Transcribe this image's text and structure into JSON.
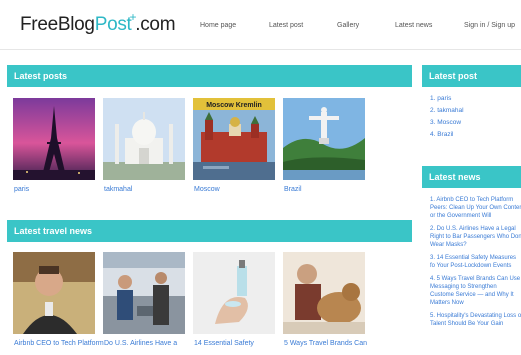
{
  "header": {
    "logo": {
      "part1": "FreeBlog",
      "part2": "Post",
      "plus": "+",
      "part3": ".com"
    },
    "nav": [
      "Home page",
      "Latest post",
      "Gallery",
      "Latest news",
      "Sign in / Sign up"
    ]
  },
  "latest_posts": {
    "title": "Latest posts",
    "items": [
      {
        "caption": "paris"
      },
      {
        "caption": "takmahal"
      },
      {
        "caption": "Moscow",
        "image_text": "Moscow Kremlin"
      },
      {
        "caption": "Brazil"
      }
    ]
  },
  "latest_travel_news": {
    "title": "Latest travel news",
    "items": [
      {
        "caption": "Airbnb CEO to Tech Platform"
      },
      {
        "caption": "Do U.S. Airlines Have a"
      },
      {
        "caption": "14 Essential Safety"
      },
      {
        "caption": "5 Ways Travel Brands Can"
      }
    ]
  },
  "sidebar": {
    "latest_post": {
      "title": "Latest post",
      "items": [
        "1. paris",
        "2. takmahal",
        "3. Moscow",
        "4. Brazil"
      ]
    },
    "latest_news": {
      "title": "Latest news",
      "items": [
        "1. Airbnb CEO to Tech Platform Peers: Clean Up Your Own Conter or the Government Will",
        "2. Do U.S. Airlines Have a Legal Right to Bar Passengers Who Don Wear Masks?",
        "3. 14 Essential Safety Measures fo Your Post-Lockdown Events",
        "4. 5 Ways Travel Brands Can Use Messaging to Strengthen Custome Service — and Why It Matters Now",
        "5. Hospitality's Devastating Loss o Talent Should Be Your Gain"
      ]
    }
  },
  "colors": {
    "accent": "#3ac5c7",
    "link": "#3a7bd5",
    "logo_accent": "#2eb8c6"
  }
}
